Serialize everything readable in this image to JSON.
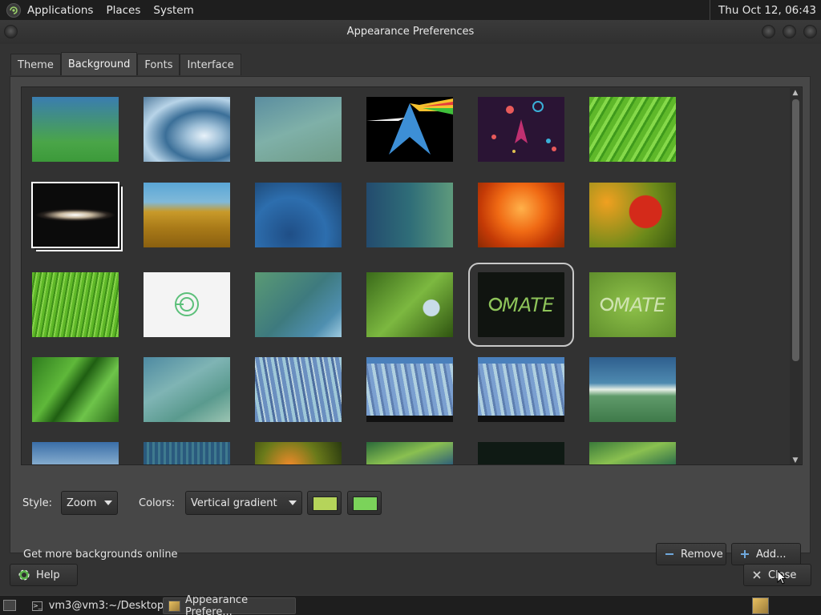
{
  "top_panel": {
    "menus": [
      "Applications",
      "Places",
      "System"
    ],
    "clock": "Thu Oct 12, 06:43"
  },
  "window": {
    "title": "Appearance Preferences",
    "tabs": [
      {
        "label": "Theme",
        "active": false
      },
      {
        "label": "Background",
        "active": true
      },
      {
        "label": "Fonts",
        "active": false
      },
      {
        "label": "Interface",
        "active": false
      }
    ]
  },
  "gallery": {
    "selected": "mate-dark",
    "thumbnails": [
      "green-blue-gradient",
      "water-droplet",
      "aqua-curves",
      "arch-prism",
      "space-rocket",
      "green-leaf",
      "sombrero-galaxy",
      "golden-grass",
      "blue-water",
      "teal-bubbles",
      "orange-flower",
      "red-marigold",
      "green-grass",
      "mate-logo-white",
      "teal-wave",
      "ladybug-leaf",
      "mate-dark",
      "mate-green",
      "leaves-drops",
      "blue-green-curves",
      "abstract-blue",
      "abstract-blue-2",
      "abstract-blue-3",
      "blue-swirl",
      "partial-1",
      "partial-2",
      "partial-3",
      "partial-4",
      "partial-5",
      "partial-6"
    ]
  },
  "controls": {
    "style_label": "Style:",
    "style_value": "Zoom",
    "colors_label": "Colors:",
    "colors_value": "Vertical gradient",
    "color1": "#b5d45a",
    "color2": "#7bd35a"
  },
  "actions": {
    "get_more": "Get more backgrounds online",
    "remove": "Remove",
    "add": "Add..."
  },
  "footer": {
    "help": "Help",
    "close": "Close"
  },
  "taskbar": {
    "items": [
      {
        "label": "vm3@vm3:~/Desktop",
        "active": false
      },
      {
        "label": "Appearance Prefere...",
        "active": true
      }
    ]
  }
}
